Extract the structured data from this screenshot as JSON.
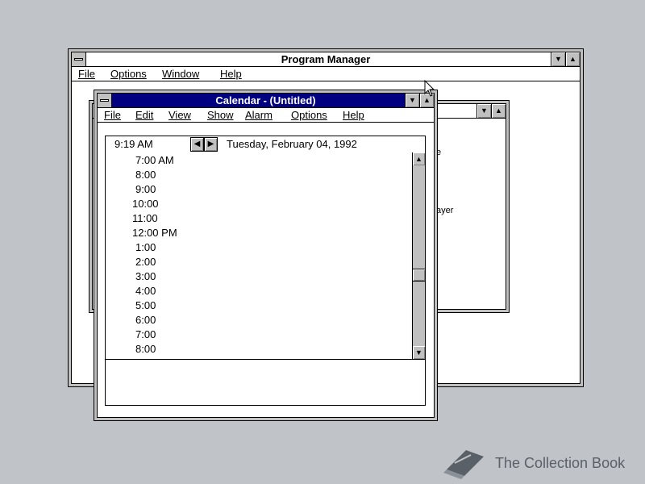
{
  "program_manager": {
    "title": "Program Manager",
    "menu": [
      "File",
      "Options",
      "Window",
      "Help"
    ]
  },
  "group_window": {
    "peek_text_1": "e",
    "peek_text_2": "ayer"
  },
  "calendar": {
    "title": "Calendar - (Untitled)",
    "menu": [
      "File",
      "Edit",
      "View",
      "Show",
      "Alarm",
      "Options",
      "Help"
    ],
    "current_time": "9:19 AM",
    "date": "Tuesday, February 04, 1992",
    "slots": [
      "7:00 AM",
      "8:00",
      "9:00",
      "10:00",
      "11:00",
      "12:00 PM",
      "1:00",
      "2:00",
      "3:00",
      "4:00",
      "5:00",
      "6:00",
      "7:00",
      "8:00"
    ],
    "scroll_position": 0.62
  },
  "watermark": {
    "text": "The Collection Book"
  },
  "icons": {
    "scroll_up": "▲",
    "scroll_down": "▼",
    "minimize": "▼",
    "maximize": "▲",
    "prev": "◆",
    "next": "◆"
  }
}
